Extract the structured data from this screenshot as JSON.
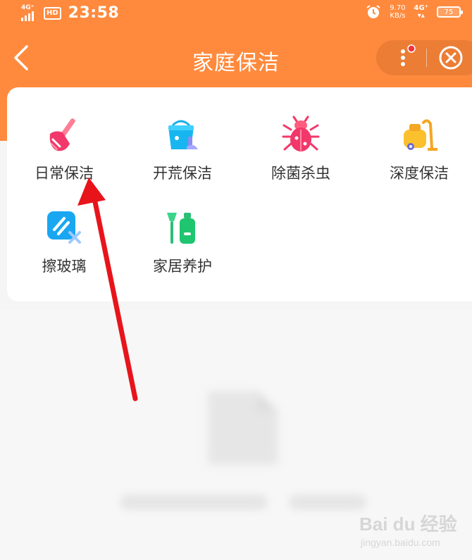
{
  "status_bar": {
    "network_left": "4G⁺",
    "hd_label": "HD",
    "time": "23:58",
    "speed_value": "9.70",
    "speed_unit": "KB/s",
    "network_right": "4G⁺",
    "battery": "75"
  },
  "nav": {
    "title": "家庭保洁"
  },
  "services": [
    {
      "label": "日常保洁",
      "icon": "broom-icon"
    },
    {
      "label": "开荒保洁",
      "icon": "bucket-icon"
    },
    {
      "label": "除菌杀虫",
      "icon": "bug-icon"
    },
    {
      "label": "深度保洁",
      "icon": "vacuum-icon"
    },
    {
      "label": "擦玻璃",
      "icon": "window-wipe-icon"
    },
    {
      "label": "家居养护",
      "icon": "care-bottle-icon"
    }
  ],
  "colors": {
    "header": "#ff8a3d",
    "annotation_arrow": "#e8141b"
  },
  "watermark": {
    "logo": "Bai du 经验",
    "url": "jingyan.baidu.com"
  }
}
